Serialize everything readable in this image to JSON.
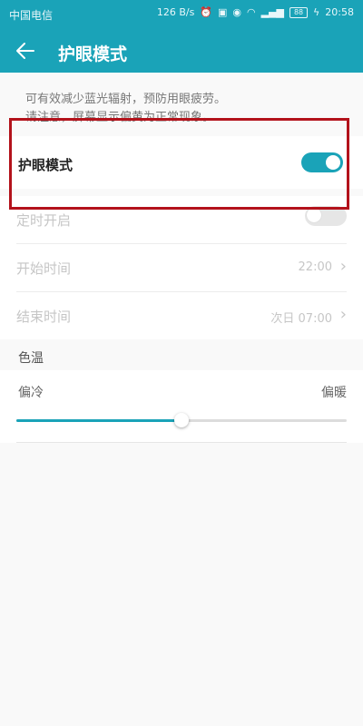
{
  "status_bar": {
    "carrier": "中国电信",
    "speed": "126 B/s",
    "battery": "88",
    "time": "20:58"
  },
  "app_bar": {
    "title": "护眼模式"
  },
  "description": {
    "line1": "可有效减少蓝光辐射，预防用眼疲劳。",
    "line2": "请注意，屏幕显示偏黄为正常现象。"
  },
  "eye_care": {
    "label": "护眼模式",
    "enabled": true
  },
  "schedule": {
    "label": "定时开启",
    "enabled": false,
    "start_label": "开始时间",
    "start_value": "22:00",
    "end_label": "结束时间",
    "end_value": "次日 07:00"
  },
  "color_temp": {
    "header": "色温",
    "cool_label": "偏冷",
    "warm_label": "偏暖",
    "level": 0.5
  },
  "colors": {
    "accent": "#1aa3b8",
    "highlight": "#b3121b"
  }
}
